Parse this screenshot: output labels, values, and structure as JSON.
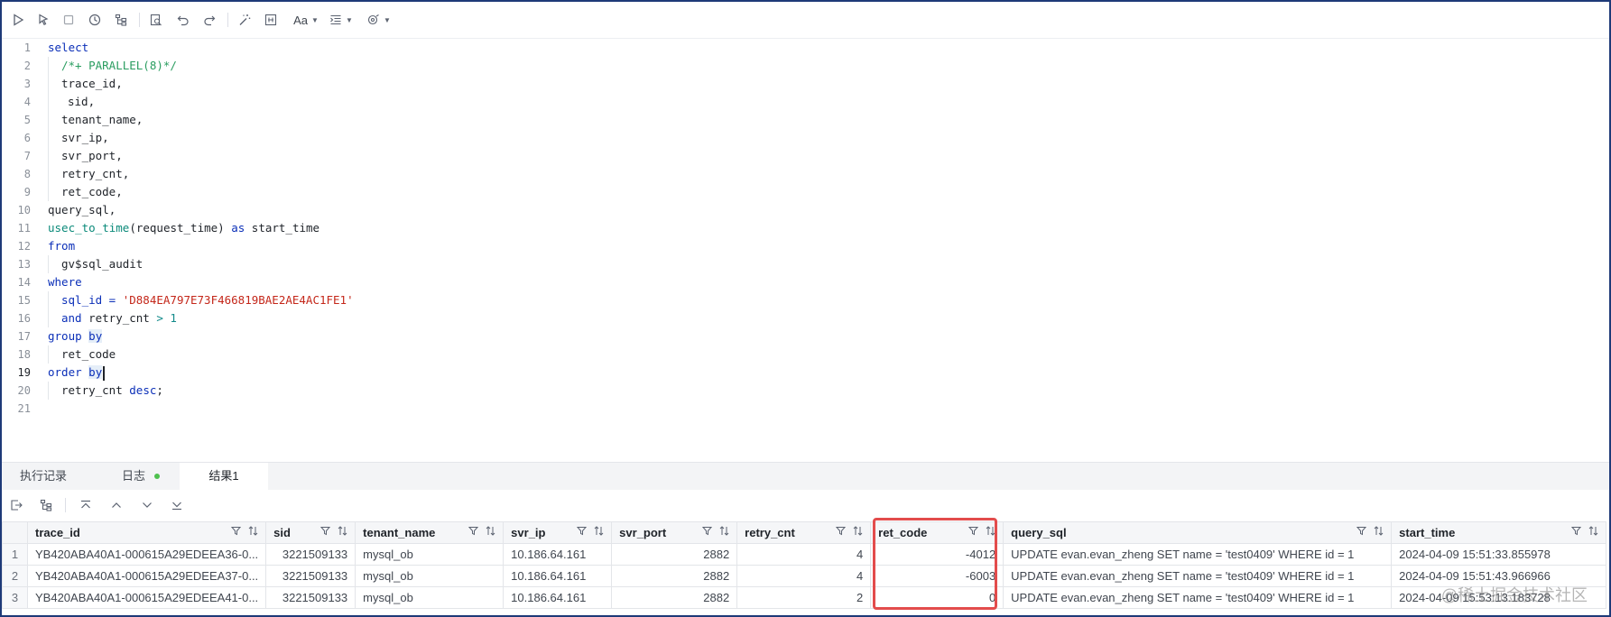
{
  "toolbar": {
    "font_label": "Aa"
  },
  "editor": {
    "active_line": 19,
    "lines": [
      {
        "n": "1"
      },
      {
        "n": "2"
      },
      {
        "n": "3"
      },
      {
        "n": "4"
      },
      {
        "n": "5"
      },
      {
        "n": "6"
      },
      {
        "n": "7"
      },
      {
        "n": "8"
      },
      {
        "n": "9"
      },
      {
        "n": "10"
      },
      {
        "n": "11"
      },
      {
        "n": "12"
      },
      {
        "n": "13"
      },
      {
        "n": "14"
      },
      {
        "n": "15"
      },
      {
        "n": "16"
      },
      {
        "n": "17"
      },
      {
        "n": "18"
      },
      {
        "n": "19"
      },
      {
        "n": "20"
      },
      {
        "n": "21"
      }
    ],
    "code": {
      "l1_kw": "select",
      "l2_comment": "/*+ PARALLEL(8)*/",
      "l3": "trace_id,",
      "l4": "sid,",
      "l5": "tenant_name,",
      "l6": "svr_ip,",
      "l7": "svr_port,",
      "l8": "retry_cnt,",
      "l9": "ret_code,",
      "l10": "query_sql,",
      "l11_fn": "usec_to_time",
      "l11_arg": "(request_time) ",
      "l11_kw": "as",
      "l11_rest": " start_time",
      "l12_kw": "from",
      "l13": "gv$sql_audit",
      "l14_kw": "where",
      "l15_col": "sql_id",
      "l15_op": " = ",
      "l15_str": "'D884EA797E73F466819BAE2AE4AC1FE1'",
      "l16_kw": "and",
      "l16_col": " retry_cnt ",
      "l16_op": ">",
      "l16_num": " 1",
      "l17_kw1": "group",
      "l17_kw2": "by",
      "l18": "ret_code",
      "l19_kw1": "order",
      "l19_kw2": "by",
      "l20_col": "retry_cnt ",
      "l20_kw": "desc",
      "l20_end": ";"
    }
  },
  "tabs": [
    {
      "label": "执行记录"
    },
    {
      "label": "日志"
    },
    {
      "label": "结果1"
    }
  ],
  "result": {
    "columns": [
      "trace_id",
      "sid",
      "tenant_name",
      "svr_ip",
      "svr_port",
      "retry_cnt",
      "ret_code",
      "query_sql",
      "start_time"
    ],
    "rows": [
      {
        "n": "1",
        "trace_id": "YB420ABA40A1-000615A29EDEEA36-0...",
        "sid": "3221509133",
        "tenant_name": "mysql_ob",
        "svr_ip": "10.186.64.161",
        "svr_port": "2882",
        "retry_cnt": "4",
        "ret_code": "-4012",
        "query_sql": "UPDATE evan.evan_zheng SET name = 'test0409' WHERE id = 1",
        "start_time": "2024-04-09 15:51:33.855978"
      },
      {
        "n": "2",
        "trace_id": "YB420ABA40A1-000615A29EDEEA37-0...",
        "sid": "3221509133",
        "tenant_name": "mysql_ob",
        "svr_ip": "10.186.64.161",
        "svr_port": "2882",
        "retry_cnt": "4",
        "ret_code": "-6003",
        "query_sql": "UPDATE evan.evan_zheng SET name = 'test0409' WHERE id = 1",
        "start_time": "2024-04-09 15:51:43.966966"
      },
      {
        "n": "3",
        "trace_id": "YB420ABA40A1-000615A29EDEEA41-0...",
        "sid": "3221509133",
        "tenant_name": "mysql_ob",
        "svr_ip": "10.186.64.161",
        "svr_port": "2882",
        "retry_cnt": "2",
        "ret_code": "0",
        "query_sql": "UPDATE evan.evan_zheng SET name = 'test0409' WHERE id = 1",
        "start_time": "2024-04-09 15:53:13.183728"
      }
    ]
  },
  "watermark": "@稀土掘金技术社区",
  "colors": {
    "frame": "#1e3a78",
    "highlight": "#e34c4c",
    "keyword": "#0b2fb8",
    "string": "#c4271a",
    "comment": "#2a9d60",
    "log_dot": "#4ec04e"
  }
}
